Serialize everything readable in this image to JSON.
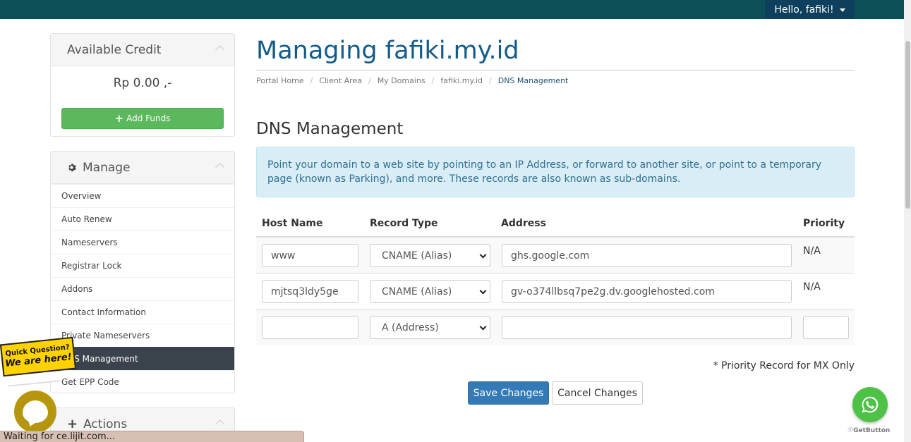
{
  "header": {
    "user_greeting": "Hello, fafiki!"
  },
  "sidebar": {
    "credit": {
      "title": "Available Credit",
      "amount": "Rp 0.00 ,-",
      "add_funds_label": "Add Funds"
    },
    "manage": {
      "title": "Manage",
      "items": [
        {
          "label": "Overview"
        },
        {
          "label": "Auto Renew"
        },
        {
          "label": "Nameservers"
        },
        {
          "label": "Registrar Lock"
        },
        {
          "label": "Addons"
        },
        {
          "label": "Contact Information"
        },
        {
          "label": "Private Nameservers"
        },
        {
          "label": "DNS Management"
        },
        {
          "label": "Get EPP Code"
        }
      ]
    },
    "actions": {
      "title": "Actions"
    }
  },
  "main": {
    "page_title": "Managing fafiki.my.id",
    "breadcrumb": [
      "Portal Home",
      "Client Area",
      "My Domains",
      "fafiki.my.id",
      "DNS Management"
    ],
    "section_title": "DNS Management",
    "info_text": "Point your domain to a web site by pointing to an IP Address, or forward to another site, or point to a temporary page (known as Parking), and more. These records are also known as sub-domains.",
    "table": {
      "headers": [
        "Host Name",
        "Record Type",
        "Address",
        "Priority"
      ],
      "rows": [
        {
          "host": "www",
          "type": "CNAME (Alias)",
          "address": "ghs.google.com",
          "priority": "N/A"
        },
        {
          "host": "mjtsq3ldy5ge",
          "type": "CNAME (Alias)",
          "address": "gv-o374llbsq7pe2g.dv.googlehosted.com",
          "priority": "N/A"
        },
        {
          "host": "",
          "type": "A (Address)",
          "address": "",
          "priority": ""
        }
      ]
    },
    "mx_note": "* Priority Record for MX Only",
    "save_label": "Save Changes",
    "cancel_label": "Cancel Changes"
  },
  "widgets": {
    "quick_question_line1": "Quick Question?",
    "quick_question_line2": "We are here!",
    "getbutton_label": "GetButton"
  },
  "status_bar": "Waiting for ce.lijit.com...",
  "colors": {
    "topbar": "#0b4f57",
    "title": "#145b8a",
    "success": "#5cb85c",
    "primary": "#337ab7",
    "active_menu": "#3a434b",
    "whatsapp": "#4dc247"
  }
}
